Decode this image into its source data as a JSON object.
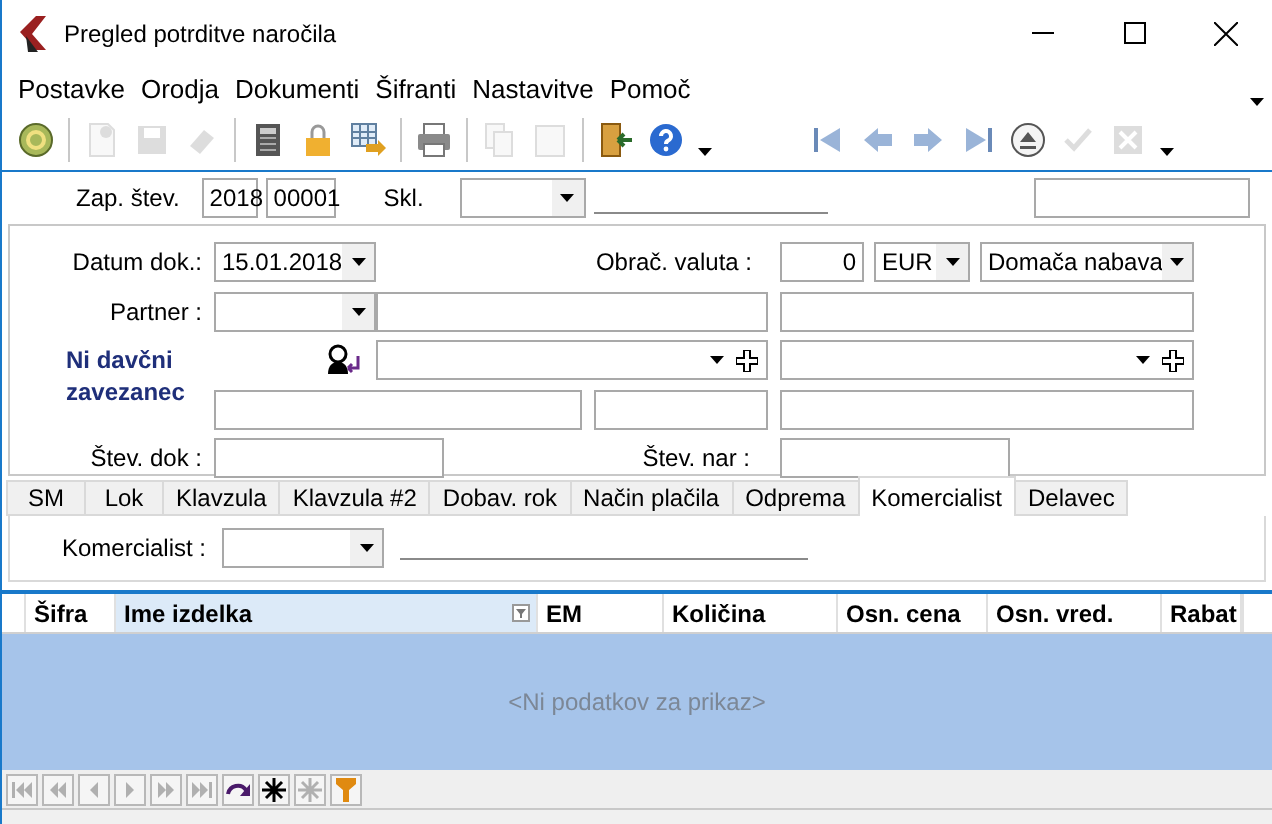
{
  "window": {
    "title": "Pregled potrditve naročila"
  },
  "menu": [
    "Postavke",
    "Orodja",
    "Dokumenti",
    "Šifranti",
    "Nastavitve",
    "Pomoč"
  ],
  "toolbar": [
    {
      "kind": "refresh",
      "disabled": false
    },
    {
      "kind": "separator"
    },
    {
      "kind": "new",
      "disabled": true
    },
    {
      "kind": "save",
      "disabled": true
    },
    {
      "kind": "erase",
      "disabled": true
    },
    {
      "kind": "separator"
    },
    {
      "kind": "calculator",
      "disabled": false
    },
    {
      "kind": "lock",
      "disabled": false
    },
    {
      "kind": "table",
      "disabled": false
    },
    {
      "kind": "separator"
    },
    {
      "kind": "print",
      "disabled": false
    },
    {
      "kind": "separator"
    },
    {
      "kind": "copy",
      "disabled": true
    },
    {
      "kind": "paste",
      "disabled": true
    },
    {
      "kind": "separator"
    },
    {
      "kind": "exit",
      "disabled": false
    },
    {
      "kind": "help",
      "disabled": false
    },
    {
      "kind": "caret"
    },
    {
      "kind": "gap"
    },
    {
      "kind": "first",
      "disabled": false
    },
    {
      "kind": "prev",
      "disabled": false
    },
    {
      "kind": "next",
      "disabled": false
    },
    {
      "kind": "last",
      "disabled": false
    },
    {
      "kind": "eject",
      "disabled": false
    },
    {
      "kind": "check",
      "disabled": true
    },
    {
      "kind": "cancel",
      "disabled": true
    },
    {
      "kind": "caret"
    }
  ],
  "header": {
    "number_label": "Zap. štev.",
    "year": "2018",
    "number": "00001",
    "warehouse_label": "Skl."
  },
  "document": {
    "date_label": "Datum dok.:",
    "date": "15.01.2018",
    "currency_label": "Obrač. valuta :",
    "rate": "0",
    "currency": "EUR",
    "purchase_type": "Domača nabava",
    "partner_label": "Partner :",
    "tax_status": "Ni davčni zavezanec",
    "doc_number_label": "Štev. dok :",
    "order_number_label": "Štev. nar :"
  },
  "tabs": [
    {
      "label": "SM",
      "selected": false
    },
    {
      "label": "Lok",
      "selected": false
    },
    {
      "label": "Klavzula",
      "selected": false
    },
    {
      "label": "Klavzula #2",
      "selected": false
    },
    {
      "label": "Dobav. rok",
      "selected": false
    },
    {
      "label": "Način plačila",
      "selected": false
    },
    {
      "label": "Odprema",
      "selected": false
    },
    {
      "label": "Komercialist",
      "selected": true
    },
    {
      "label": "Delavec",
      "selected": false
    }
  ],
  "tab_panel": {
    "label": "Komercialist :"
  },
  "table": {
    "columns": [
      {
        "label": "Šifra",
        "selected": false
      },
      {
        "label": "Ime izdelka",
        "selected": true
      },
      {
        "label": "EM",
        "selected": false
      },
      {
        "label": "Količina",
        "selected": false
      },
      {
        "label": "Osn. cena",
        "selected": false
      },
      {
        "label": "Osn. vred.",
        "selected": false
      },
      {
        "label": "Rabat",
        "selected": false
      }
    ],
    "empty_message": "<Ni podatkov za prikaz>"
  },
  "navigator": [
    {
      "kind": "first",
      "disabled": true
    },
    {
      "kind": "prev-page",
      "disabled": true
    },
    {
      "kind": "prev",
      "disabled": true
    },
    {
      "kind": "next",
      "disabled": true
    },
    {
      "kind": "next-page",
      "disabled": true
    },
    {
      "kind": "last",
      "disabled": true
    },
    {
      "kind": "redo",
      "disabled": false
    },
    {
      "kind": "asterisk",
      "disabled": false
    },
    {
      "kind": "asterisk",
      "disabled": true
    },
    {
      "kind": "filter",
      "disabled": false
    }
  ]
}
